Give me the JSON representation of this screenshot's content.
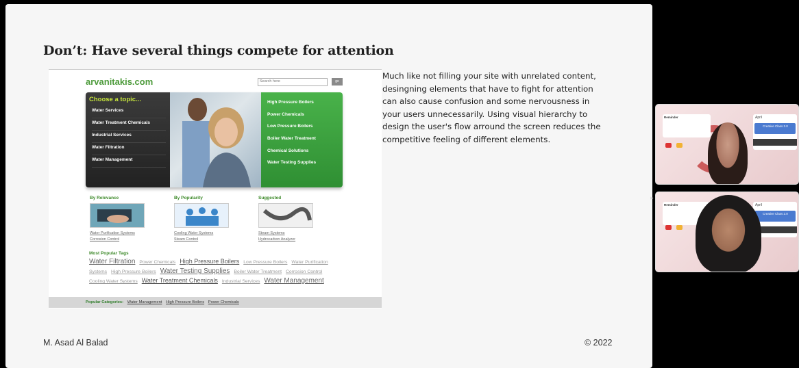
{
  "slide": {
    "title": "Don’t: Have several things compete for attention",
    "body": "Much like not filling your site with unrelated content, desingning elements that have to fight for attention can also cause confusion and some nervousness in your users unnecessarily. Using visual hierarchy to design the user's flow arround the screen reduces the competitive feeling of different elements.",
    "footer_left": "M. Asad Al Balad",
    "footer_right": "© 2022"
  },
  "site": {
    "logo": "arvanitakis.com",
    "search_placeholder": "Search here",
    "search_button": "go",
    "choose_heading": "Choose a topic...",
    "left_menu": [
      "Water Services",
      "Water Treatment Chemicals",
      "Industrial Services",
      "Water Filtration",
      "Water Management"
    ],
    "right_menu": [
      "High Pressure Boilers",
      "Power Chemicals",
      "Low Pressure Boilers",
      "Boiler Water Treatment",
      "Chemical Solutions",
      "Water Testing Supplies"
    ],
    "columns": [
      {
        "heading": "By Relevance",
        "links": [
          "Water Purification Systems",
          "Corrosion Control"
        ]
      },
      {
        "heading": "By Popularity",
        "links": [
          "Cooling Water Systems",
          "Steam Control"
        ]
      },
      {
        "heading": "Suggested",
        "links": [
          "Steam Systems",
          "Hydrocarbon Analyzer"
        ]
      }
    ],
    "tags_heading": "Most Popular Tags",
    "tags": [
      "Water Filtration",
      "Power Chemicals",
      "High Pressure Boilers",
      "Low Pressure Boilers",
      "Water Purification Systems",
      "High Pressure Boilers",
      "Water Testing Supplies",
      "Boiler Water Treatment",
      "Corrosion Control",
      "Cooling Water Systems",
      "Water Treatment Chemicals",
      "Industrial Services",
      "Water Management"
    ],
    "popular_label": "Popular Categories:",
    "popular_links": [
      "Water Management",
      "High Pressure Boilers",
      "Power Chemicals"
    ]
  },
  "tiles": {
    "reminder": "Reminder",
    "month": "April",
    "class_name": "Creative Class 2.0"
  },
  "colors": {
    "green": "#49b24a",
    "dark": "#2b2b2b",
    "slide_bg": "#f6f6f6"
  }
}
